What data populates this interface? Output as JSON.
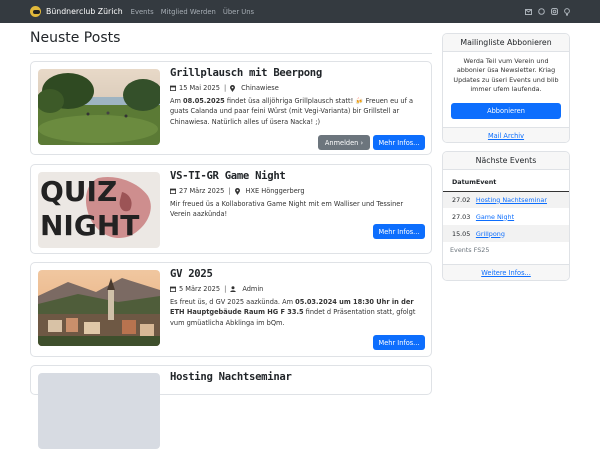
{
  "nav": {
    "brand": "Bündnerclub Zürich",
    "links": [
      "Events",
      "Mitglied Werden",
      "Über Uns"
    ],
    "icons": [
      "mail-icon",
      "whatsapp-icon",
      "instagram-icon",
      "lightbulb-icon"
    ]
  },
  "main": {
    "title": "Neuste Posts",
    "posts": [
      {
        "title": "Grillplausch mit Beerpong",
        "date": "15 Mai 2025",
        "location": "Chinawiese",
        "text_prefix": "Am ",
        "text_bold": "08.05.2025",
        "text_rest": " findet üsa alljöhriga Grillplausch statt! 🍻 Freuen eu uf a guats Calanda und paar feini Würst (mit Vegi-Varianta) bir Grillstell ar Chinawiesa. Natürlich alles uf üsera Nacka! ;)",
        "btn_register": "Anmelden ›",
        "btn_more": "Mehr Infos..."
      },
      {
        "title": "VS-TI-GR Game Night",
        "date": "27 März 2025",
        "location": "HXE Hönggerberg",
        "text": "Mir freued üs a Kollaborativa Game Night mit em Walliser und Tessiner Verein aazkünda!",
        "thumb_line1": "QUIZ",
        "thumb_line2": "NIGHT",
        "btn_more": "Mehr Infos..."
      },
      {
        "title": "GV 2025",
        "date": "5 März 2025",
        "author": "Admin",
        "text_a": "Es freut üs, d GV 2025 aazkünda. Am ",
        "text_b": "05.03.2024 um 18:30 Uhr in der ETH Hauptgebäude Raum HG F 33.5",
        "text_c": " findet d Präsentation statt, gfolgt vum gmüatlicha Abklinga im bQm.",
        "btn_more": "Mehr Infos..."
      },
      {
        "title_partial": "Hosting Nachtseminar"
      }
    ]
  },
  "sidebar": {
    "newsletter": {
      "header": "Mailingliste Abbonieren",
      "text": "Werda Teil vum Verein und abbonier üsa Newsletter. Kriag Updates zu üseri Events und blib immer ufem laufenda.",
      "button": "Abbonieren",
      "footer": "Mail Archiv"
    },
    "events": {
      "header": "Nächste Events",
      "col_date": "Datum",
      "col_event": "Event",
      "rows": [
        {
          "date": "27.02",
          "event": "Hosting Nachtseminar"
        },
        {
          "date": "27.03",
          "event": "Game Night"
        },
        {
          "date": "15.05",
          "event": "Grillpong"
        }
      ],
      "caption": "Events FS25",
      "footer": "Weitere Infos..."
    }
  },
  "colors": {
    "navbar": "#343a40",
    "primary": "#0d6efd",
    "secondary": "#6c757d"
  }
}
